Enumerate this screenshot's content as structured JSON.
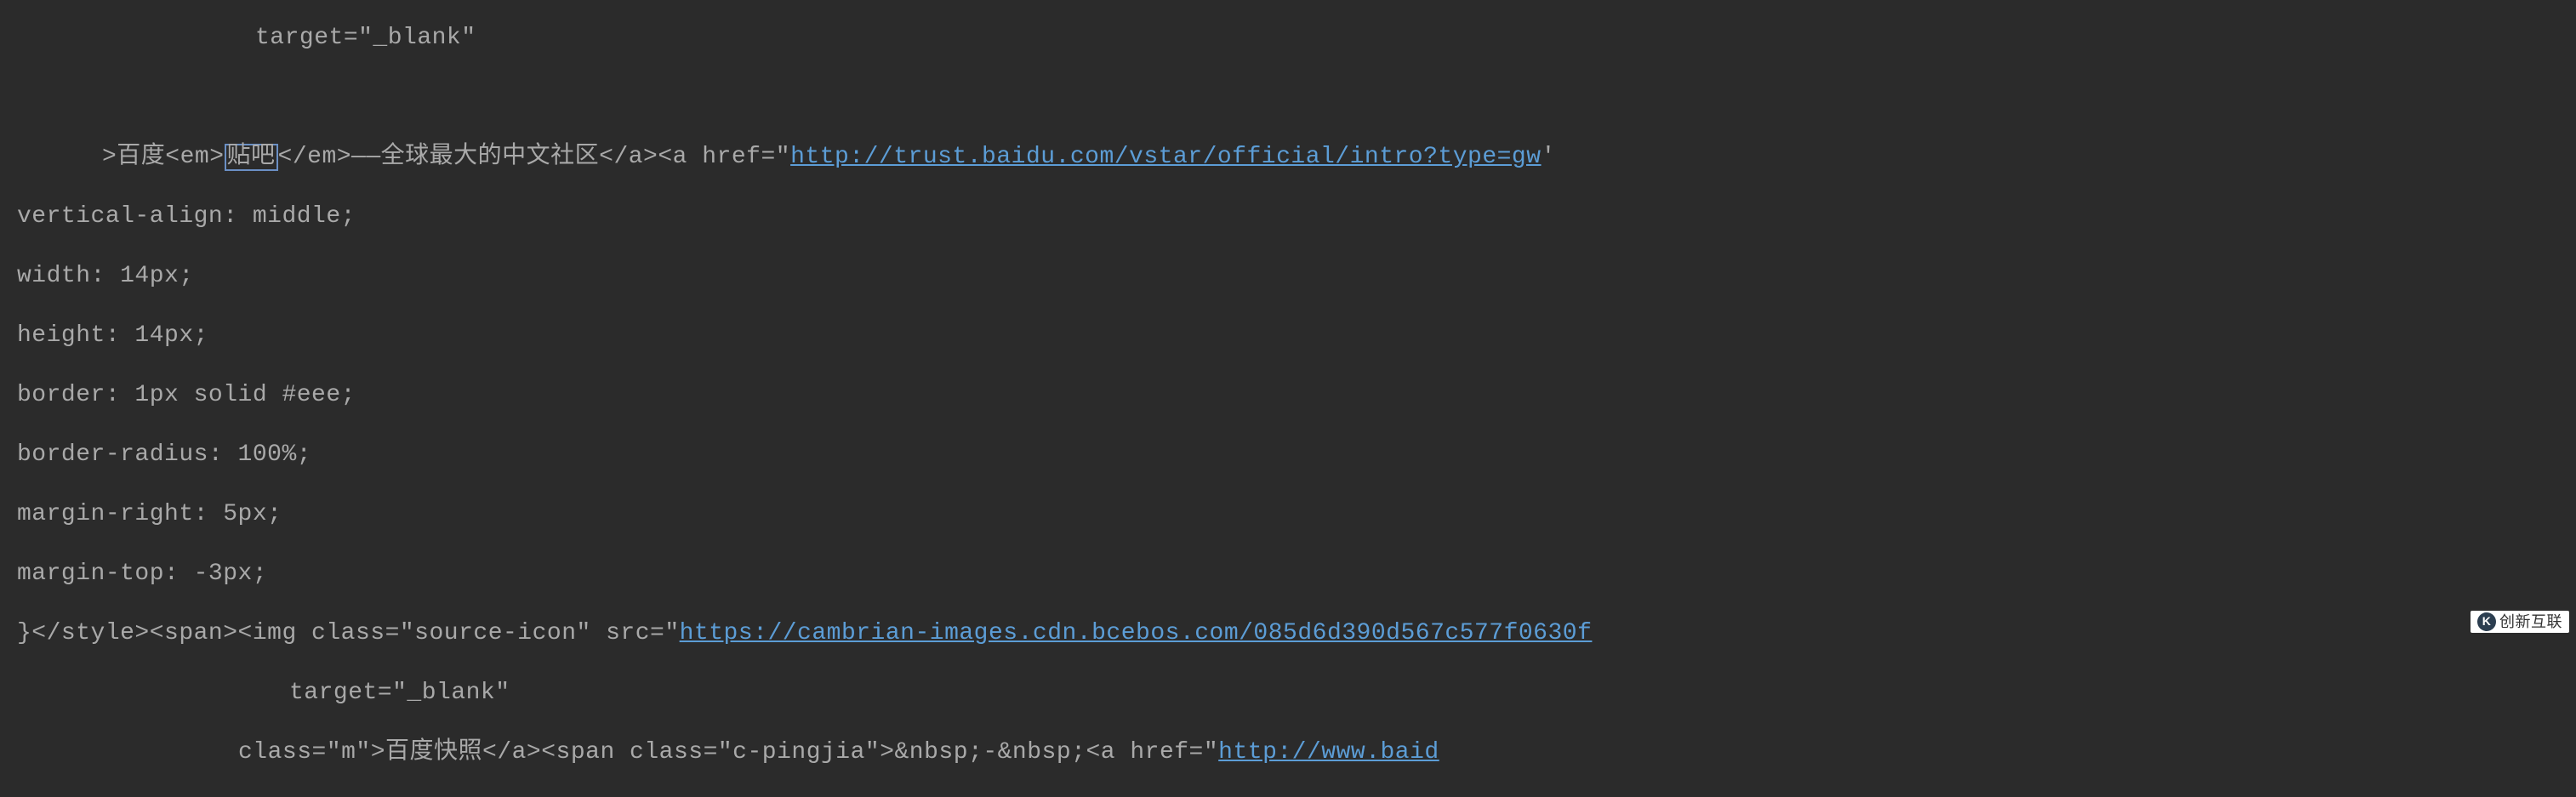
{
  "code": {
    "line1_indent": "target=\"_blank\"",
    "line2_prefix": ">百度<em>",
    "line2_highlighted": "贴吧",
    "line2_suffix": "</em>——全球最大的中文社区</a><a href=\"",
    "line2_url": "http://trust.baidu.com/vstar/official/intro?type=gw",
    "line2_end": "'",
    "line3": "vertical-align: middle;",
    "line4": "width: 14px;",
    "line5": "height: 14px;",
    "line6": "border: 1px solid #eee;",
    "line7": "border-radius: 100%;",
    "line8": "margin-right: 5px;",
    "line9": "margin-top: -3px;",
    "line10_prefix": "}</style><span><img class=\"source-icon\" src=\"",
    "line10_url": "https://cambrian-images.cdn.bcebos.com/085d6d390d567c577f0630f",
    "line11": "target=\"_blank\"",
    "line12_prefix": "class=\"m\">百度快照</a><span class=\"c-pingjia\">&nbsp;-&nbsp;<a href=\"",
    "line12_url": "http://www.baid"
  },
  "watermark": {
    "icon_text": "K",
    "label": "创新互联"
  }
}
